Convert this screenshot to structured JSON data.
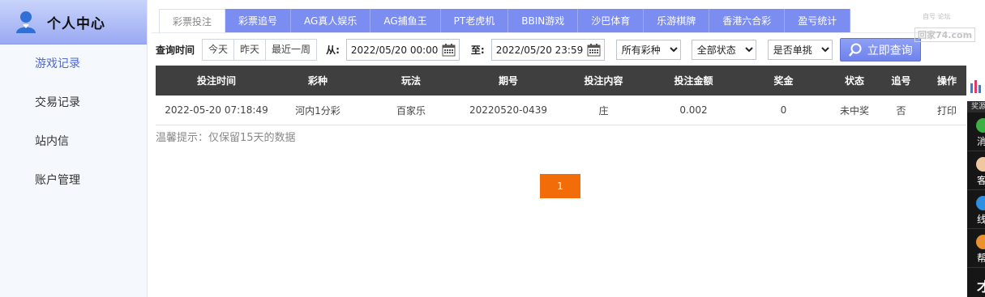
{
  "sidebar": {
    "title": "个人中心",
    "items": [
      {
        "label": "游戏记录",
        "active": true
      },
      {
        "label": "交易记录",
        "active": false
      },
      {
        "label": "站内信",
        "active": false
      },
      {
        "label": "账户管理",
        "active": false
      }
    ]
  },
  "tabs": [
    {
      "label": "彩票投注",
      "active": true
    },
    {
      "label": "彩票追号"
    },
    {
      "label": "AG真人娱乐"
    },
    {
      "label": "AG捕鱼王"
    },
    {
      "label": "PT老虎机"
    },
    {
      "label": "BBIN游戏"
    },
    {
      "label": "沙巴体育"
    },
    {
      "label": "乐游棋牌"
    },
    {
      "label": "香港六合彩"
    },
    {
      "label": "盈亏统计"
    }
  ],
  "filter": {
    "time_label": "查询时间",
    "quick": [
      "今天",
      "昨天",
      "最近一周"
    ],
    "from_label": "从:",
    "from_value": "2022/05/20 00:00",
    "to_label": "至:",
    "to_value": "2022/05/20 23:59",
    "lottery_select": "所有彩种",
    "status_select": "全部状态",
    "single_select": "是否单挑",
    "query_label": "立即查询"
  },
  "table": {
    "headers": [
      "投注时间",
      "彩种",
      "玩法",
      "期号",
      "投注内容",
      "投注金额",
      "奖金",
      "状态",
      "追号",
      "操作"
    ],
    "rows": [
      [
        "2022-05-20 07:18:49",
        "河内1分彩",
        "百家乐",
        "20220520-0439",
        "庄",
        "0.002",
        "0",
        "未中奖",
        "否",
        "打印"
      ]
    ]
  },
  "tip": "温馨提示：仅保留15天的数据",
  "pagination": {
    "current": "1"
  },
  "watermark": {
    "small": "自号 论坛",
    "text": "回家74.com"
  },
  "right_bar": {
    "label": "奖源",
    "items": [
      {
        "label": "消",
        "icon": "chat-icon",
        "color": "#3cb043"
      },
      {
        "label": "客",
        "icon": "service-icon",
        "color": "#f0c8a0"
      },
      {
        "label": "线",
        "icon": "line-icon",
        "color": "#2f8fe0"
      },
      {
        "label": "帮",
        "icon": "help-icon",
        "color": "#e9922e"
      },
      {
        "label": "才",
        "icon": "more-icon",
        "color": "#161616"
      }
    ]
  },
  "colors": {
    "accent": "#7b8df0",
    "table_header": "#3f3f3f",
    "pager": "#f26d09",
    "active_link": "#4d68d8"
  }
}
